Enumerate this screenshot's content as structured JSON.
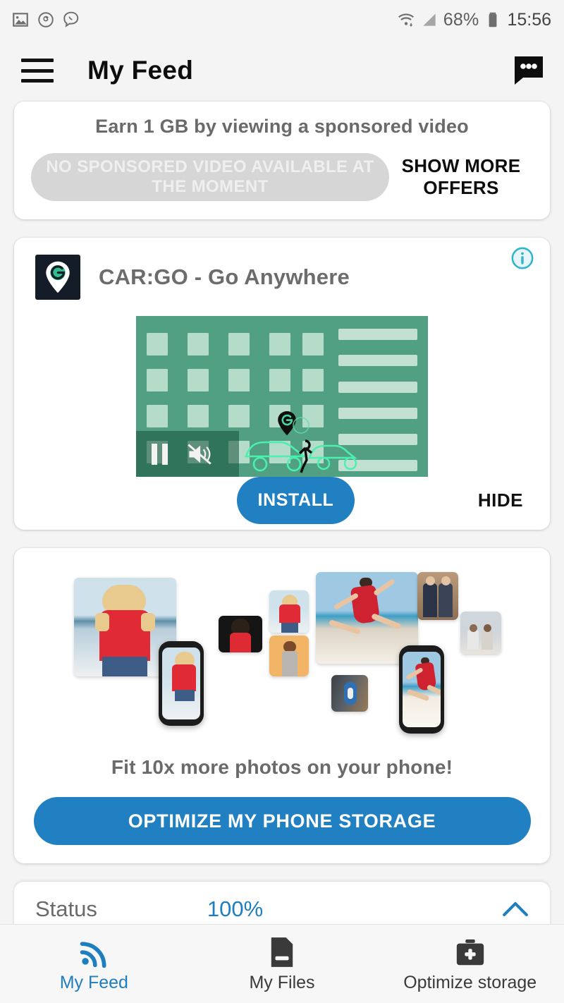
{
  "statusbar": {
    "left_icons": [
      "photo-icon",
      "threads-icon",
      "viber-icon"
    ],
    "right_icons": [
      "wifi-icon",
      "signal-icon",
      "battery-icon"
    ],
    "battery_percent": "68%",
    "time": "15:56"
  },
  "appbar": {
    "menu_icon": "hamburger-menu-icon",
    "title": "My Feed",
    "chat_icon": "chat-bubble-icon"
  },
  "sponsored_card": {
    "title": "Earn 1 GB by viewing a sponsored video",
    "button_label": "NO SPONSORED VIDEO AVAILABLE AT THE MOMENT",
    "button_enabled": "false",
    "more_offers_label": "SHOW MORE OFFERS"
  },
  "ad_card": {
    "info_icon": "info-icon",
    "logo_icon": "cargo-pin-logo-icon",
    "app_name": "CAR:GO - Go Anywhere",
    "video": {
      "pause_icon": "pause-icon",
      "mute_icon": "speaker-muted-icon",
      "background_color": "#52a083",
      "accent_color": "#b5dbc9"
    },
    "install_label": "INSTALL",
    "hide_label": "HIDE"
  },
  "optimizer_card": {
    "headline": "Fit 10x more photos on your phone!",
    "cta_label": "OPTIMIZE MY PHONE STORAGE"
  },
  "status_strip": {
    "label": "Status",
    "percent": "100%",
    "chevron_icon": "chevron-up-icon"
  },
  "bottom_nav": {
    "items": [
      {
        "label": "My Feed",
        "icon": "rss-feed-icon",
        "active": "true"
      },
      {
        "label": "My Files",
        "icon": "file-document-icon",
        "active": "false"
      },
      {
        "label": "Optimize storage",
        "icon": "toolbox-plus-icon",
        "active": "false"
      }
    ]
  },
  "colors": {
    "accent_blue": "#2180c2",
    "ad_green": "#52a083",
    "page_background": "#f4f4f4",
    "card_background": "#ffffff",
    "muted_text": "#6a6a6a"
  }
}
